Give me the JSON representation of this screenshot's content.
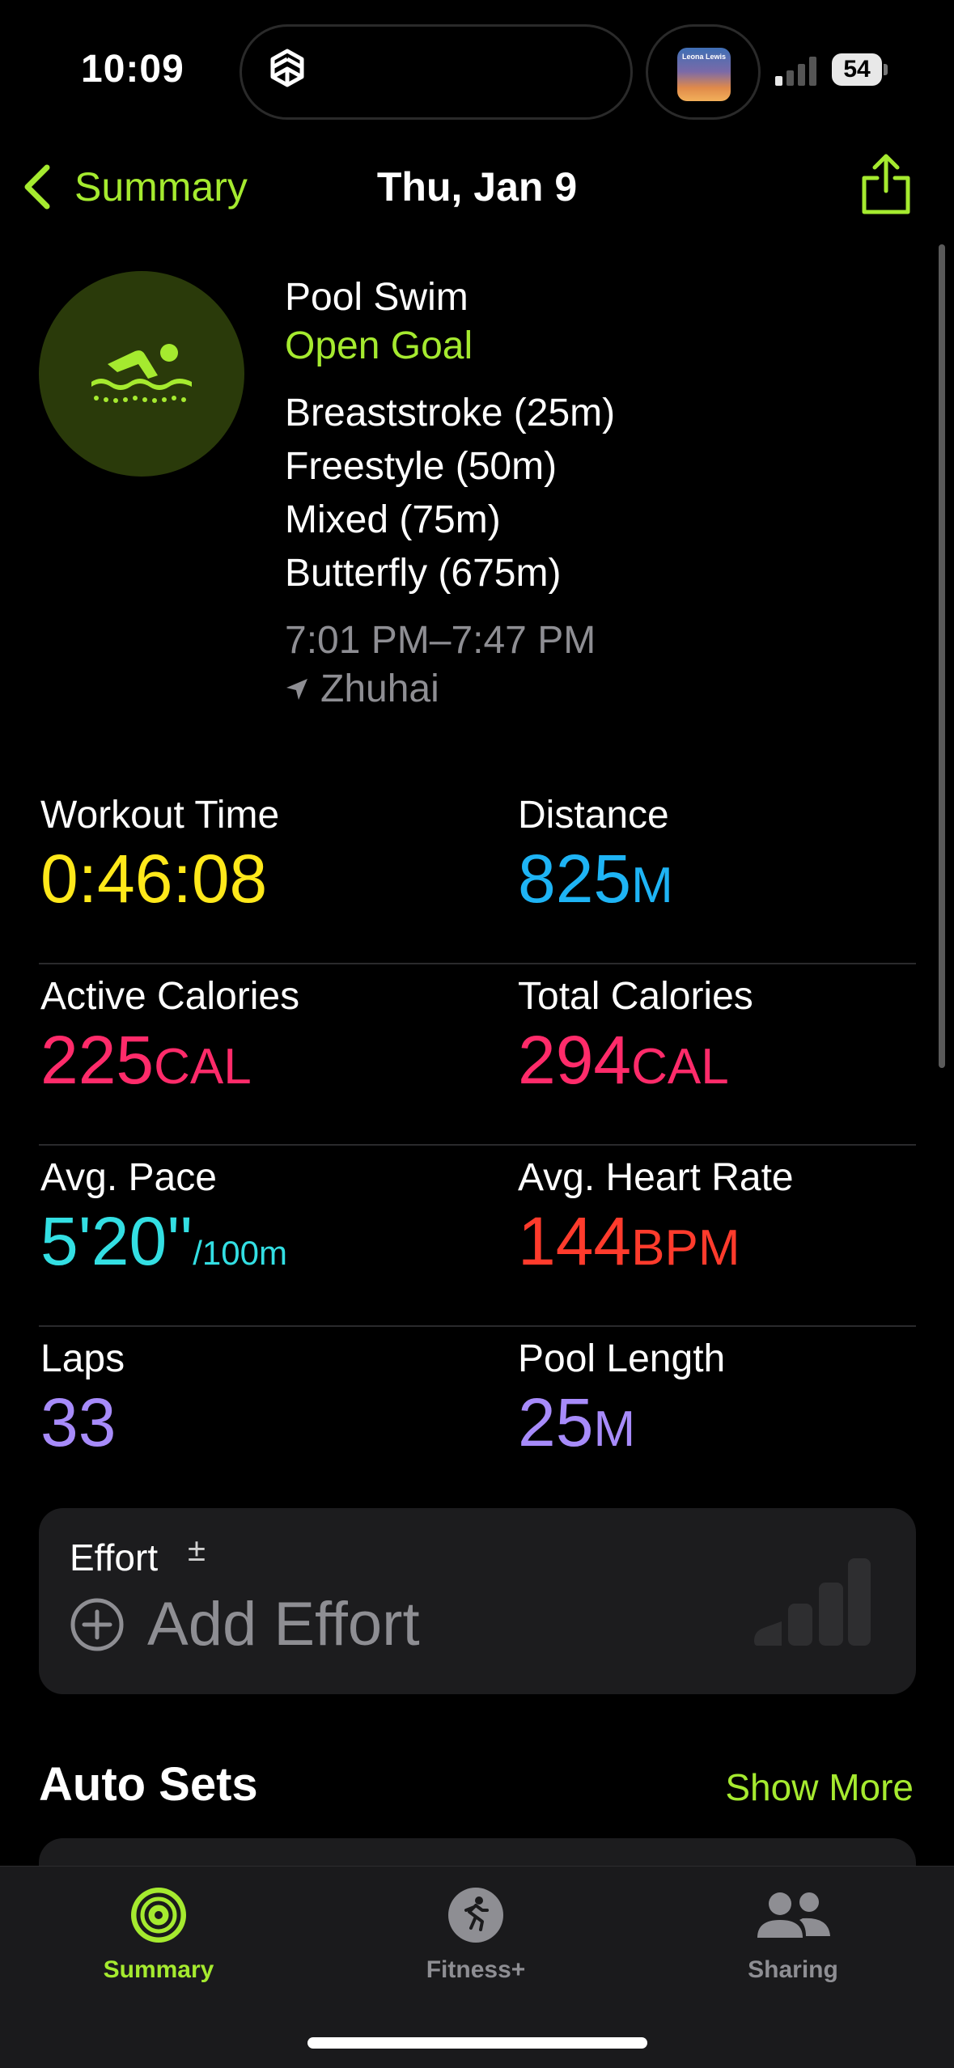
{
  "status_bar": {
    "time": "10:09",
    "battery": "54",
    "now_playing_album_text": "Leona Lewis"
  },
  "nav": {
    "back_label": "Summary",
    "title": "Thu, Jan 9"
  },
  "workout": {
    "icon": "swimming-icon",
    "title": "Pool Swim",
    "goal": "Open Goal",
    "strokes": [
      "Breaststroke (25m)",
      "Freestyle (50m)",
      "Mixed (75m)",
      "Butterfly (675m)"
    ],
    "time_range": "7:01 PM–7:47 PM",
    "location": "Zhuhai"
  },
  "metrics": {
    "workout_time": {
      "label": "Workout Time",
      "value": "0:46:08"
    },
    "distance": {
      "label": "Distance",
      "value": "825",
      "unit": "M"
    },
    "active_calories": {
      "label": "Active Calories",
      "value": "225",
      "unit": "CAL"
    },
    "total_calories": {
      "label": "Total Calories",
      "value": "294",
      "unit": "CAL"
    },
    "avg_pace": {
      "label": "Avg. Pace",
      "value": "5'20''",
      "unit": "/100m"
    },
    "avg_heart_rate": {
      "label": "Avg. Heart Rate",
      "value": "144",
      "unit": "BPM"
    },
    "laps": {
      "label": "Laps",
      "value": "33"
    },
    "pool_length": {
      "label": "Pool Length",
      "value": "25",
      "unit": "M"
    }
  },
  "effort": {
    "label": "Effort",
    "symbol": "±",
    "add_label": "Add Effort"
  },
  "auto_sets": {
    "title": "Auto Sets",
    "show_more": "Show More"
  },
  "tabs": [
    {
      "label": "Summary",
      "icon": "activity-rings-icon",
      "active": true
    },
    {
      "label": "Fitness+",
      "icon": "fitness-plus-icon",
      "active": false
    },
    {
      "label": "Sharing",
      "icon": "sharing-people-icon",
      "active": false
    }
  ],
  "colors": {
    "accent": "#a5ea2f",
    "workout_time": "#ffe81a",
    "distance": "#1eb4f5",
    "calories": "#ff2b6a",
    "pace": "#33dfe3",
    "heart_rate": "#ff3b2c",
    "laps": "#a78bfa"
  }
}
